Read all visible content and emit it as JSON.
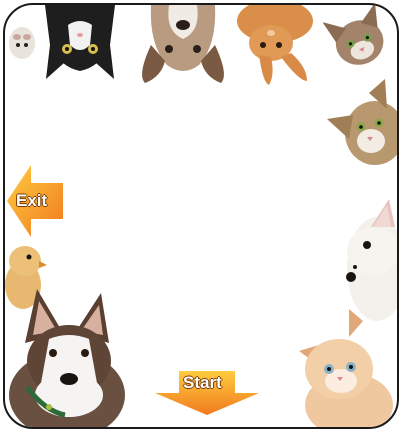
{
  "buttons": {
    "exit_label": "Exit",
    "start_label": "Start"
  },
  "icons": {
    "exit": "arrow-left-icon",
    "start": "arrow-down-icon"
  },
  "colors": {
    "frame_border": "#1a1a1a",
    "arrow_light": "#ffcc40",
    "arrow_dark": "#f07a1e",
    "background": "#ffffff"
  },
  "animals": [
    {
      "kind": "hamster",
      "orientation": "upside-down"
    },
    {
      "kind": "tuxedo-cat",
      "orientation": "upside-down"
    },
    {
      "kind": "puppy",
      "orientation": "upside-down"
    },
    {
      "kind": "rabbit",
      "orientation": "upside-down"
    },
    {
      "kind": "tabby-kitten",
      "orientation": "tilted"
    },
    {
      "kind": "tabby-kitten",
      "orientation": "sideways"
    },
    {
      "kind": "chick",
      "orientation": "upright"
    },
    {
      "kind": "chihuahua",
      "orientation": "sideways"
    },
    {
      "kind": "husky-puppy",
      "orientation": "upright"
    },
    {
      "kind": "ginger-kitten",
      "orientation": "upright"
    }
  ]
}
